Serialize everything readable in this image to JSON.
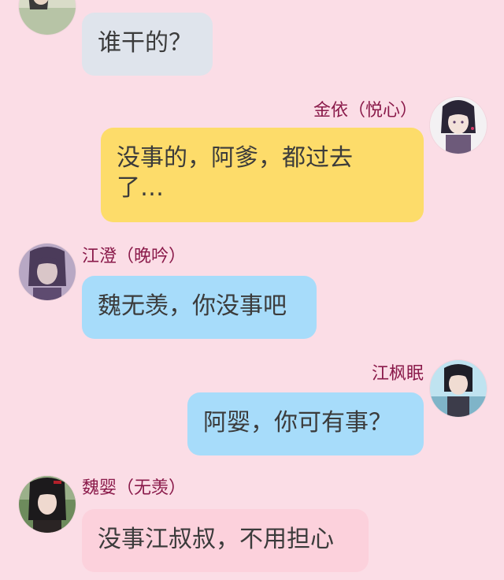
{
  "colors": {
    "background": "#fbdde6",
    "name_color": "#8a1a4a",
    "bubble_gray": "#dfe4ec",
    "bubble_yellow": "#fddc6a",
    "bubble_blue": "#a7dcfa",
    "bubble_pink": "#fcd1dc"
  },
  "messages": [
    {
      "side": "left",
      "sender": "",
      "text": "谁干的？",
      "avatar_icon": "character-avatar-icon"
    },
    {
      "side": "right",
      "sender": "金依（悦心）",
      "text": "没事的，阿爹，都过去了…",
      "avatar_icon": "character-avatar-icon"
    },
    {
      "side": "left",
      "sender": "江澄（晚吟）",
      "text": "魏无羡，你没事吧",
      "avatar_icon": "character-avatar-icon"
    },
    {
      "side": "right",
      "sender": "江枫眠",
      "text": "阿婴，你可有事？",
      "avatar_icon": "character-avatar-icon"
    },
    {
      "side": "left",
      "sender": "魏婴（无羡）",
      "text": "没事江叔叔，不用担心",
      "avatar_icon": "character-avatar-icon"
    }
  ]
}
